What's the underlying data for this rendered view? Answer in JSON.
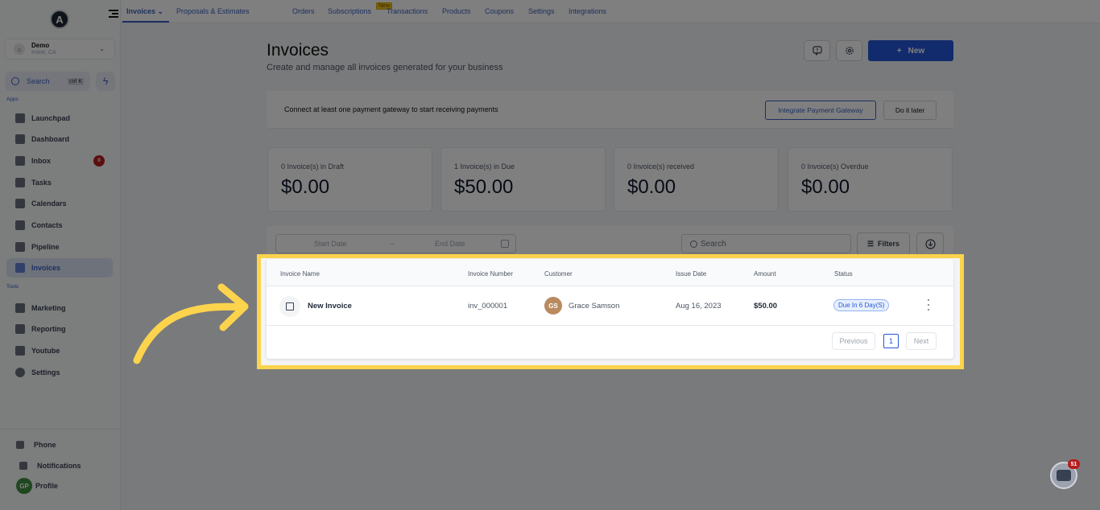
{
  "sidebar": {
    "logo": "A",
    "location": {
      "name": "Demo",
      "sub": "Irvine, CA"
    },
    "search": {
      "label": "Search",
      "shortcut": "ctrl K"
    },
    "apps_label": "Apps",
    "tools_label": "Tools",
    "apps": [
      {
        "label": "Launchpad",
        "icon": "rocket-icon"
      },
      {
        "label": "Dashboard",
        "icon": "dashboard-icon"
      },
      {
        "label": "Inbox",
        "icon": "inbox-icon",
        "badge": "0"
      },
      {
        "label": "Tasks",
        "icon": "clipboard-icon"
      },
      {
        "label": "Calendars",
        "icon": "calendar-icon"
      },
      {
        "label": "Contacts",
        "icon": "contact-icon"
      },
      {
        "label": "Pipeline",
        "icon": "funnel-icon"
      },
      {
        "label": "Invoices",
        "icon": "invoice-icon",
        "active": true
      }
    ],
    "tools": [
      {
        "label": "Marketing",
        "icon": "megaphone-icon"
      },
      {
        "label": "Reporting",
        "icon": "pie-chart-icon"
      },
      {
        "label": "Youtube",
        "icon": "youtube-icon"
      },
      {
        "label": "Settings",
        "icon": "gear-icon"
      }
    ],
    "bottom": [
      {
        "label": "Phone",
        "icon": "phone-icon"
      },
      {
        "label": "Notifications",
        "icon": "bell-icon"
      },
      {
        "label": "Profile",
        "avatar": "GP"
      }
    ]
  },
  "topnav": {
    "tabs": [
      "Invoices",
      "Proposals & Estimates",
      "Orders",
      "Subscriptions",
      "Transactions",
      "Products",
      "Coupons",
      "Settings",
      "Integrations"
    ],
    "new_tag": "New",
    "active_tab": "Invoices"
  },
  "header": {
    "title": "Invoices",
    "subtitle": "Create and manage all invoices generated for your business",
    "new_button": "New"
  },
  "banner": {
    "text": "Connect at least one payment gateway to start receiving payments",
    "primary": "Integrate Payment Gateway",
    "secondary": "Do it later"
  },
  "stats": [
    {
      "label": "0 Invoice(s) in Draft",
      "value": "$0.00"
    },
    {
      "label": "1 Invoice(s) in Due",
      "value": "$50.00"
    },
    {
      "label": "0 Invoice(s) received",
      "value": "$0.00"
    },
    {
      "label": "0 Invoice(s) Overdue",
      "value": "$0.00"
    }
  ],
  "filters": {
    "start_placeholder": "Start Date",
    "end_placeholder": "End Date",
    "search_placeholder": "Search",
    "filters_label": "Filters"
  },
  "table": {
    "columns": [
      "Invoice Name",
      "Invoice Number",
      "Customer",
      "Issue Date",
      "Amount",
      "Status"
    ],
    "rows": [
      {
        "name": "New Invoice",
        "number": "inv_000001",
        "customer_initials": "GS",
        "customer": "Grace Samson",
        "issue_date": "Aug 16, 2023",
        "amount": "$50.00",
        "status": "Due In 6 Day(S)"
      }
    ],
    "pagination": {
      "previous": "Previous",
      "page": "1",
      "next": "Next"
    }
  },
  "chat": {
    "badge": "51"
  },
  "colors": {
    "accent": "#2456d8",
    "highlight": "#fcd34d",
    "danger": "#b91c1c"
  }
}
